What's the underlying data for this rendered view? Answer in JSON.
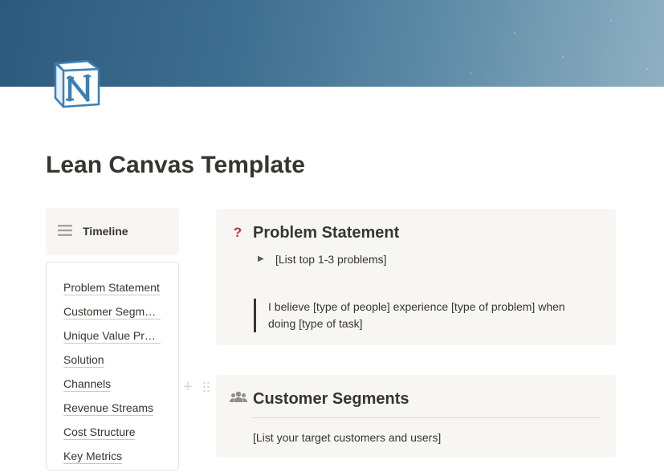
{
  "page": {
    "title": "Lean Canvas Template",
    "icon": "notion-logo-icon"
  },
  "sidebar": {
    "timeline": {
      "label": "Timeline",
      "icon": "list-icon"
    },
    "toc": [
      {
        "label": "Problem Statement"
      },
      {
        "label": "Customer Segments"
      },
      {
        "label": "Unique Value Proposition"
      },
      {
        "label": "Solution"
      },
      {
        "label": "Channels"
      },
      {
        "label": "Revenue Streams"
      },
      {
        "label": "Cost Structure"
      },
      {
        "label": "Key Metrics"
      }
    ]
  },
  "blocks": [
    {
      "heading": "Problem Statement",
      "icon": "question-mark-icon",
      "toggle": "[List top 1-3 problems]",
      "quote": "I believe [type of people] experience [type of problem] when doing [type of task]"
    },
    {
      "heading": "Customer Segments",
      "icon": "people-icon",
      "body": "[List your target customers and users]"
    }
  ],
  "colors": {
    "text": "#37352f",
    "callout_bg": "#f7f6f3",
    "question_red": "#c5303a",
    "cover_start": "#2c5a7e",
    "cover_end": "#8fb0c2"
  }
}
